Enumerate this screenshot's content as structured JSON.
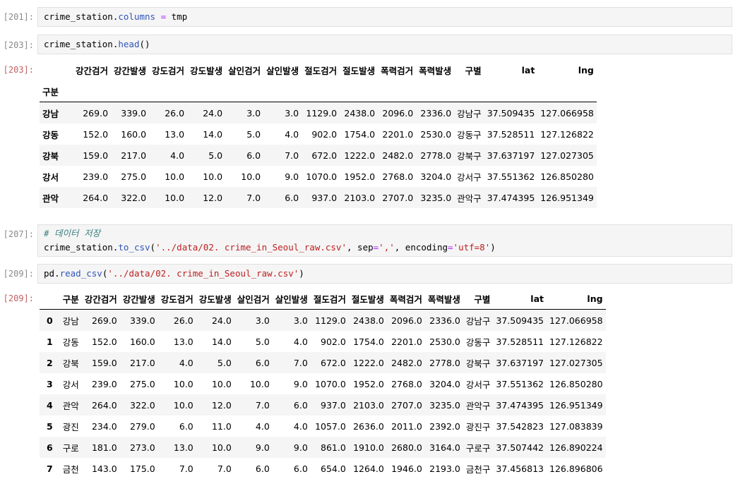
{
  "cells": [
    {
      "prompt": "[201]:",
      "code": {
        "var": "crime_station",
        "dot": ".",
        "attr": "columns",
        "op": " = ",
        "rest": "tmp"
      }
    },
    {
      "prompt": "[203]:",
      "code": {
        "var": "crime_station",
        "dot": ".",
        "attr": "head",
        "rest": "()"
      }
    },
    {
      "prompt": "[207]:",
      "comment": "# 데이터 저장",
      "code": {
        "var": "crime_station",
        "dot": ".",
        "attr": "to_csv",
        "p1": "(",
        "s1": "'../data/02. crime_in_Seoul_raw.csv'",
        "c1": ", sep",
        "op1": "=",
        "s2": "','",
        "c2": ", encoding",
        "op2": "=",
        "s3": "'utf=8'",
        "p2": ")"
      }
    },
    {
      "prompt": "[209]:",
      "code": {
        "var": "pd",
        "dot": ".",
        "attr": "read_csv",
        "p1": "(",
        "s1": "'../data/02. crime_in_Seoul_raw.csv'",
        "p2": ")"
      }
    }
  ],
  "out1": {
    "prompt": "[203]:",
    "columns": [
      "강간검거",
      "강간발생",
      "강도검거",
      "강도발생",
      "살인검거",
      "살인발생",
      "절도검거",
      "절도발생",
      "폭력검거",
      "폭력발생",
      "구별",
      "lat",
      "lng"
    ],
    "index_name": "구분",
    "rows": [
      [
        "강남",
        "269.0",
        "339.0",
        "26.0",
        "24.0",
        "3.0",
        "3.0",
        "1129.0",
        "2438.0",
        "2096.0",
        "2336.0",
        "강남구",
        "37.509435",
        "127.066958"
      ],
      [
        "강동",
        "152.0",
        "160.0",
        "13.0",
        "14.0",
        "5.0",
        "4.0",
        "902.0",
        "1754.0",
        "2201.0",
        "2530.0",
        "강동구",
        "37.528511",
        "127.126822"
      ],
      [
        "강북",
        "159.0",
        "217.0",
        "4.0",
        "5.0",
        "6.0",
        "7.0",
        "672.0",
        "1222.0",
        "2482.0",
        "2778.0",
        "강북구",
        "37.637197",
        "127.027305"
      ],
      [
        "강서",
        "239.0",
        "275.0",
        "10.0",
        "10.0",
        "10.0",
        "9.0",
        "1070.0",
        "1952.0",
        "2768.0",
        "3204.0",
        "강서구",
        "37.551362",
        "126.850280"
      ],
      [
        "관악",
        "264.0",
        "322.0",
        "10.0",
        "12.0",
        "7.0",
        "6.0",
        "937.0",
        "2103.0",
        "2707.0",
        "3235.0",
        "관악구",
        "37.474395",
        "126.951349"
      ]
    ]
  },
  "out2": {
    "prompt": "[209]:",
    "columns": [
      "구분",
      "강간검거",
      "강간발생",
      "강도검거",
      "강도발생",
      "살인검거",
      "살인발생",
      "절도검거",
      "절도발생",
      "폭력검거",
      "폭력발생",
      "구별",
      "lat",
      "lng"
    ],
    "rows": [
      [
        "0",
        "강남",
        "269.0",
        "339.0",
        "26.0",
        "24.0",
        "3.0",
        "3.0",
        "1129.0",
        "2438.0",
        "2096.0",
        "2336.0",
        "강남구",
        "37.509435",
        "127.066958"
      ],
      [
        "1",
        "강동",
        "152.0",
        "160.0",
        "13.0",
        "14.0",
        "5.0",
        "4.0",
        "902.0",
        "1754.0",
        "2201.0",
        "2530.0",
        "강동구",
        "37.528511",
        "127.126822"
      ],
      [
        "2",
        "강북",
        "159.0",
        "217.0",
        "4.0",
        "5.0",
        "6.0",
        "7.0",
        "672.0",
        "1222.0",
        "2482.0",
        "2778.0",
        "강북구",
        "37.637197",
        "127.027305"
      ],
      [
        "3",
        "강서",
        "239.0",
        "275.0",
        "10.0",
        "10.0",
        "10.0",
        "9.0",
        "1070.0",
        "1952.0",
        "2768.0",
        "3204.0",
        "강서구",
        "37.551362",
        "126.850280"
      ],
      [
        "4",
        "관악",
        "264.0",
        "322.0",
        "10.0",
        "12.0",
        "7.0",
        "6.0",
        "937.0",
        "2103.0",
        "2707.0",
        "3235.0",
        "관악구",
        "37.474395",
        "126.951349"
      ],
      [
        "5",
        "광진",
        "234.0",
        "279.0",
        "6.0",
        "11.0",
        "4.0",
        "4.0",
        "1057.0",
        "2636.0",
        "2011.0",
        "2392.0",
        "광진구",
        "37.542823",
        "127.083839"
      ],
      [
        "6",
        "구로",
        "181.0",
        "273.0",
        "13.0",
        "10.0",
        "9.0",
        "9.0",
        "861.0",
        "1910.0",
        "2680.0",
        "3164.0",
        "구로구",
        "37.507442",
        "126.890224"
      ],
      [
        "7",
        "금천",
        "143.0",
        "175.0",
        "7.0",
        "7.0",
        "6.0",
        "6.0",
        "654.0",
        "1264.0",
        "1946.0",
        "2193.0",
        "금천구",
        "37.456813",
        "126.896806"
      ]
    ]
  }
}
